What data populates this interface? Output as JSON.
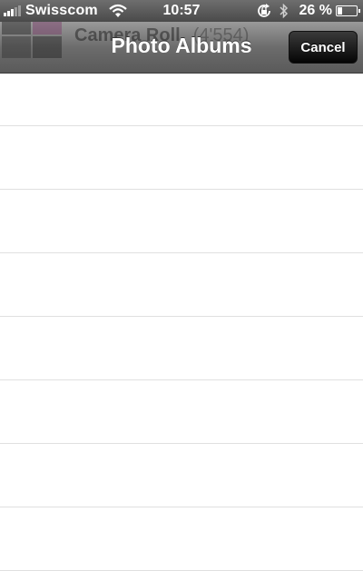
{
  "status_bar": {
    "carrier": "Swisscom",
    "time": "10:57",
    "battery_percent": "26 %",
    "battery_level": 0.26,
    "signal_bars": 3,
    "icons": [
      "signal-icon",
      "wifi-icon",
      "rotation-lock-icon",
      "bluetooth-icon",
      "battery-icon"
    ]
  },
  "nav_bar": {
    "title": "Photo Albums",
    "cancel_label": "Cancel"
  },
  "background_row": {
    "album_name": "Camera Roll",
    "count": "(4'554)"
  },
  "table": {
    "row_count": 8
  }
}
